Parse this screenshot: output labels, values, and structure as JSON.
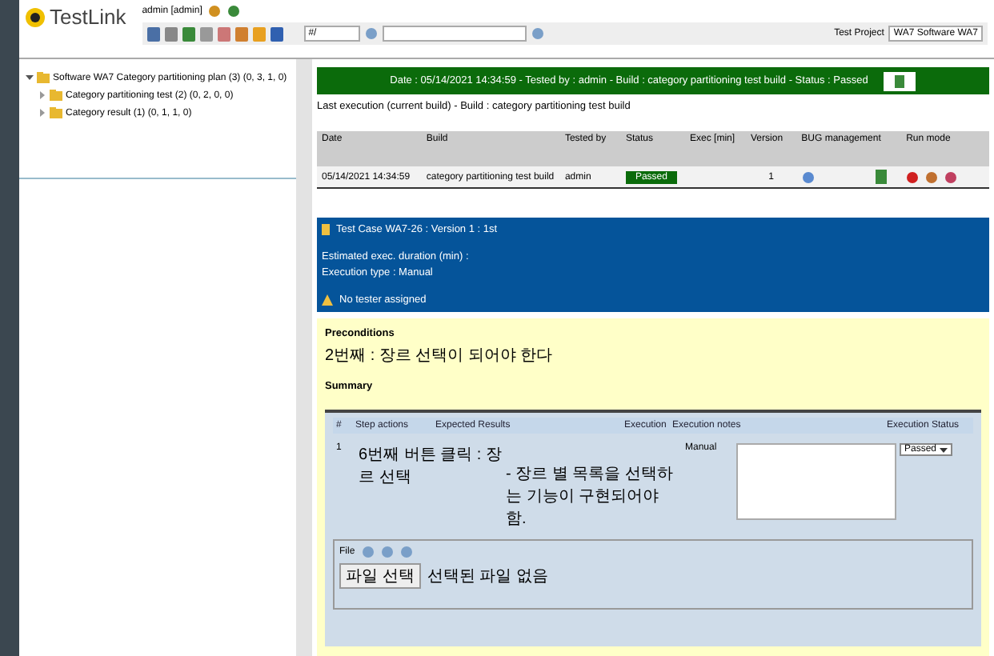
{
  "header": {
    "logo": "TestLink",
    "user": "admin [admin]",
    "search_value": "#/",
    "project_label": "Test Project",
    "project_value": "WA7 Software WA7"
  },
  "tree": [
    {
      "label": "Software WA7 Category partitioning plan (3) (0, 3, 1, 0)",
      "expanded": true,
      "children": [
        {
          "label": "Category partitioning test (2) (0, 2, 0, 0)",
          "expanded": false
        },
        {
          "label": "Category result (1) (0, 1, 1, 0)",
          "expanded": false
        }
      ]
    }
  ],
  "status_banner": "Date : 05/14/2021 14:34:59 - Tested by : admin - Build : category partitioning test build - Status : Passed",
  "last_execution": "Last execution (current build) - Build : category partitioning test build",
  "exec_table": {
    "columns": [
      "Date",
      "Build",
      "Tested by",
      "Status",
      "Exec [min]",
      "Version",
      "BUG management",
      "Run mode"
    ],
    "rows": [
      {
        "date": "05/14/2021 14:34:59",
        "build": "category partitioning test build",
        "tested_by": "admin",
        "status": "Passed",
        "version": "1"
      }
    ]
  },
  "test_case": {
    "title": "Test Case WA7-26 : Version 1 : 1st",
    "duration": "Estimated exec. duration (min) :",
    "exec_type": "Execution type : Manual",
    "warning": "No tester assigned"
  },
  "preconditions": {
    "heading": "Preconditions",
    "text": "2번째 : 장르 선택이 되어야 한다",
    "summary": "Summary"
  },
  "steps": {
    "columns": [
      "#",
      "Step actions",
      "Expected Results",
      "Execution",
      "Execution notes",
      "Execution Status"
    ],
    "rows": [
      {
        "number": "1",
        "action": "6번째 버튼 클릭 : 장르 선택",
        "expected": "- 장르 별 목록을 선택하는 기능이 구현되어야 함.",
        "execution": "Manual",
        "status": "Passed"
      }
    ]
  },
  "files": {
    "label": "File",
    "button": "파일 선택",
    "note": "선택된 파일 없음"
  }
}
